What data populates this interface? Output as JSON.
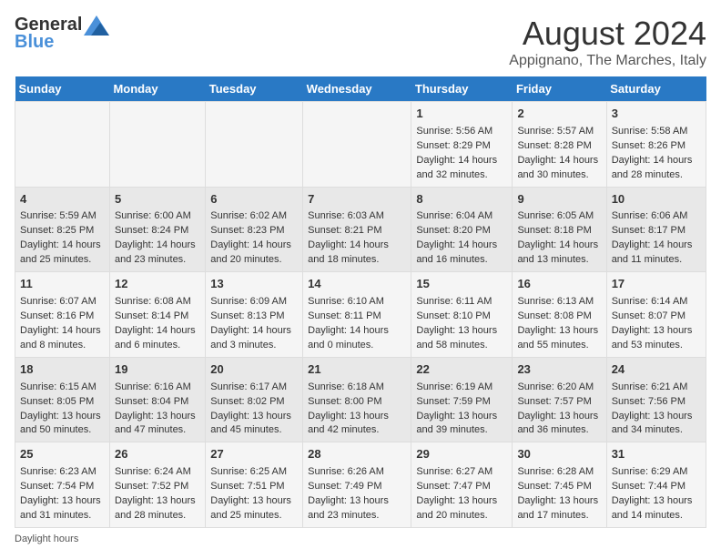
{
  "logo": {
    "general": "General",
    "blue": "Blue"
  },
  "title": "August 2024",
  "subtitle": "Appignano, The Marches, Italy",
  "days_header": [
    "Sunday",
    "Monday",
    "Tuesday",
    "Wednesday",
    "Thursday",
    "Friday",
    "Saturday"
  ],
  "weeks": [
    [
      {
        "day": "",
        "info": ""
      },
      {
        "day": "",
        "info": ""
      },
      {
        "day": "",
        "info": ""
      },
      {
        "day": "",
        "info": ""
      },
      {
        "day": "1",
        "info": "Sunrise: 5:56 AM\nSunset: 8:29 PM\nDaylight: 14 hours and 32 minutes."
      },
      {
        "day": "2",
        "info": "Sunrise: 5:57 AM\nSunset: 8:28 PM\nDaylight: 14 hours and 30 minutes."
      },
      {
        "day": "3",
        "info": "Sunrise: 5:58 AM\nSunset: 8:26 PM\nDaylight: 14 hours and 28 minutes."
      }
    ],
    [
      {
        "day": "4",
        "info": "Sunrise: 5:59 AM\nSunset: 8:25 PM\nDaylight: 14 hours and 25 minutes."
      },
      {
        "day": "5",
        "info": "Sunrise: 6:00 AM\nSunset: 8:24 PM\nDaylight: 14 hours and 23 minutes."
      },
      {
        "day": "6",
        "info": "Sunrise: 6:02 AM\nSunset: 8:23 PM\nDaylight: 14 hours and 20 minutes."
      },
      {
        "day": "7",
        "info": "Sunrise: 6:03 AM\nSunset: 8:21 PM\nDaylight: 14 hours and 18 minutes."
      },
      {
        "day": "8",
        "info": "Sunrise: 6:04 AM\nSunset: 8:20 PM\nDaylight: 14 hours and 16 minutes."
      },
      {
        "day": "9",
        "info": "Sunrise: 6:05 AM\nSunset: 8:18 PM\nDaylight: 14 hours and 13 minutes."
      },
      {
        "day": "10",
        "info": "Sunrise: 6:06 AM\nSunset: 8:17 PM\nDaylight: 14 hours and 11 minutes."
      }
    ],
    [
      {
        "day": "11",
        "info": "Sunrise: 6:07 AM\nSunset: 8:16 PM\nDaylight: 14 hours and 8 minutes."
      },
      {
        "day": "12",
        "info": "Sunrise: 6:08 AM\nSunset: 8:14 PM\nDaylight: 14 hours and 6 minutes."
      },
      {
        "day": "13",
        "info": "Sunrise: 6:09 AM\nSunset: 8:13 PM\nDaylight: 14 hours and 3 minutes."
      },
      {
        "day": "14",
        "info": "Sunrise: 6:10 AM\nSunset: 8:11 PM\nDaylight: 14 hours and 0 minutes."
      },
      {
        "day": "15",
        "info": "Sunrise: 6:11 AM\nSunset: 8:10 PM\nDaylight: 13 hours and 58 minutes."
      },
      {
        "day": "16",
        "info": "Sunrise: 6:13 AM\nSunset: 8:08 PM\nDaylight: 13 hours and 55 minutes."
      },
      {
        "day": "17",
        "info": "Sunrise: 6:14 AM\nSunset: 8:07 PM\nDaylight: 13 hours and 53 minutes."
      }
    ],
    [
      {
        "day": "18",
        "info": "Sunrise: 6:15 AM\nSunset: 8:05 PM\nDaylight: 13 hours and 50 minutes."
      },
      {
        "day": "19",
        "info": "Sunrise: 6:16 AM\nSunset: 8:04 PM\nDaylight: 13 hours and 47 minutes."
      },
      {
        "day": "20",
        "info": "Sunrise: 6:17 AM\nSunset: 8:02 PM\nDaylight: 13 hours and 45 minutes."
      },
      {
        "day": "21",
        "info": "Sunrise: 6:18 AM\nSunset: 8:00 PM\nDaylight: 13 hours and 42 minutes."
      },
      {
        "day": "22",
        "info": "Sunrise: 6:19 AM\nSunset: 7:59 PM\nDaylight: 13 hours and 39 minutes."
      },
      {
        "day": "23",
        "info": "Sunrise: 6:20 AM\nSunset: 7:57 PM\nDaylight: 13 hours and 36 minutes."
      },
      {
        "day": "24",
        "info": "Sunrise: 6:21 AM\nSunset: 7:56 PM\nDaylight: 13 hours and 34 minutes."
      }
    ],
    [
      {
        "day": "25",
        "info": "Sunrise: 6:23 AM\nSunset: 7:54 PM\nDaylight: 13 hours and 31 minutes."
      },
      {
        "day": "26",
        "info": "Sunrise: 6:24 AM\nSunset: 7:52 PM\nDaylight: 13 hours and 28 minutes."
      },
      {
        "day": "27",
        "info": "Sunrise: 6:25 AM\nSunset: 7:51 PM\nDaylight: 13 hours and 25 minutes."
      },
      {
        "day": "28",
        "info": "Sunrise: 6:26 AM\nSunset: 7:49 PM\nDaylight: 13 hours and 23 minutes."
      },
      {
        "day": "29",
        "info": "Sunrise: 6:27 AM\nSunset: 7:47 PM\nDaylight: 13 hours and 20 minutes."
      },
      {
        "day": "30",
        "info": "Sunrise: 6:28 AM\nSunset: 7:45 PM\nDaylight: 13 hours and 17 minutes."
      },
      {
        "day": "31",
        "info": "Sunrise: 6:29 AM\nSunset: 7:44 PM\nDaylight: 13 hours and 14 minutes."
      }
    ]
  ],
  "footer": "Daylight hours"
}
